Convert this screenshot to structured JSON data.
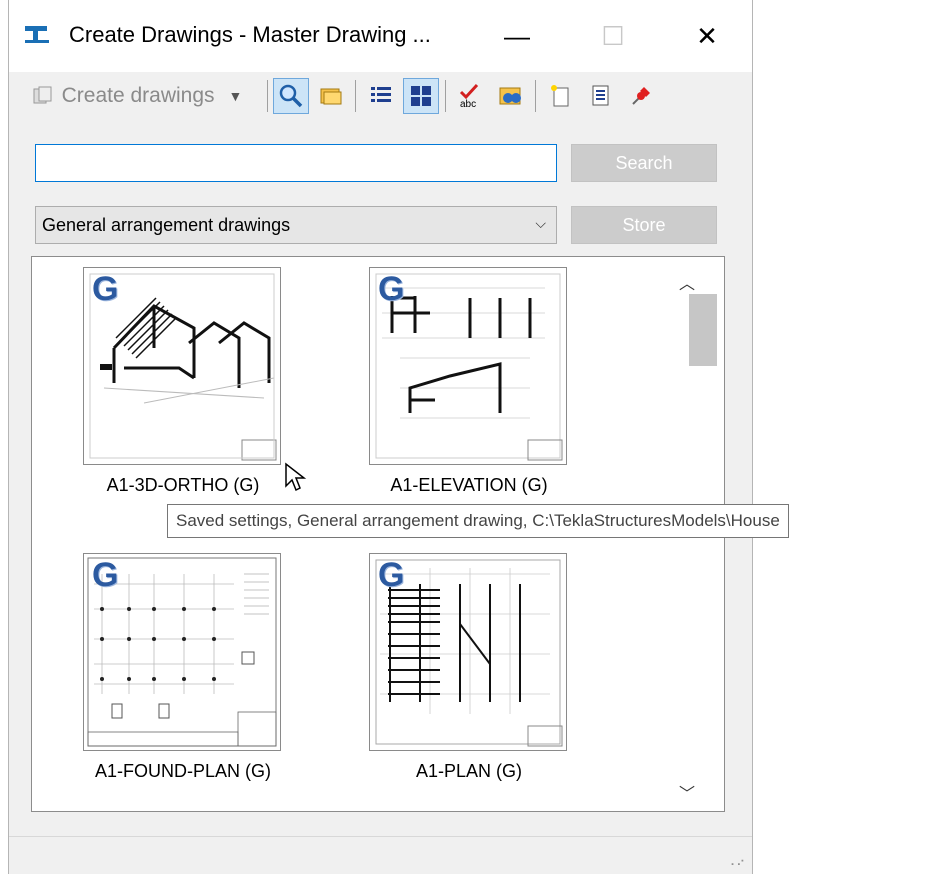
{
  "window": {
    "title": "Create Drawings - Master Drawing ..."
  },
  "toolbar": {
    "create_label": "Create drawings",
    "icons": [
      "search-icon",
      "open-folder-icon",
      "list-view-icon",
      "thumbnail-view-icon",
      "spell-check-icon",
      "binoculars-icon",
      "new-drawing-icon",
      "properties-icon",
      "pin-icon"
    ]
  },
  "search": {
    "value": "",
    "button_label": "Search"
  },
  "filter": {
    "selected": "General arrangement drawings",
    "store_label": "Store"
  },
  "drawings": [
    {
      "name": "A1-3D-ORTHO (G)",
      "badge": "G"
    },
    {
      "name": "A1-ELEVATION (G)",
      "badge": "G"
    },
    {
      "name": "A1-FOUND-PLAN (G)",
      "badge": "G"
    },
    {
      "name": "A1-PLAN (G)",
      "badge": "G"
    }
  ],
  "tooltip": "Saved settings, General arrangement drawing, C:\\TeklaStructuresModels\\House",
  "colors": {
    "accent": "#0078d7",
    "badge": "#2c5aa0",
    "disabled_button": "#cccccc"
  }
}
